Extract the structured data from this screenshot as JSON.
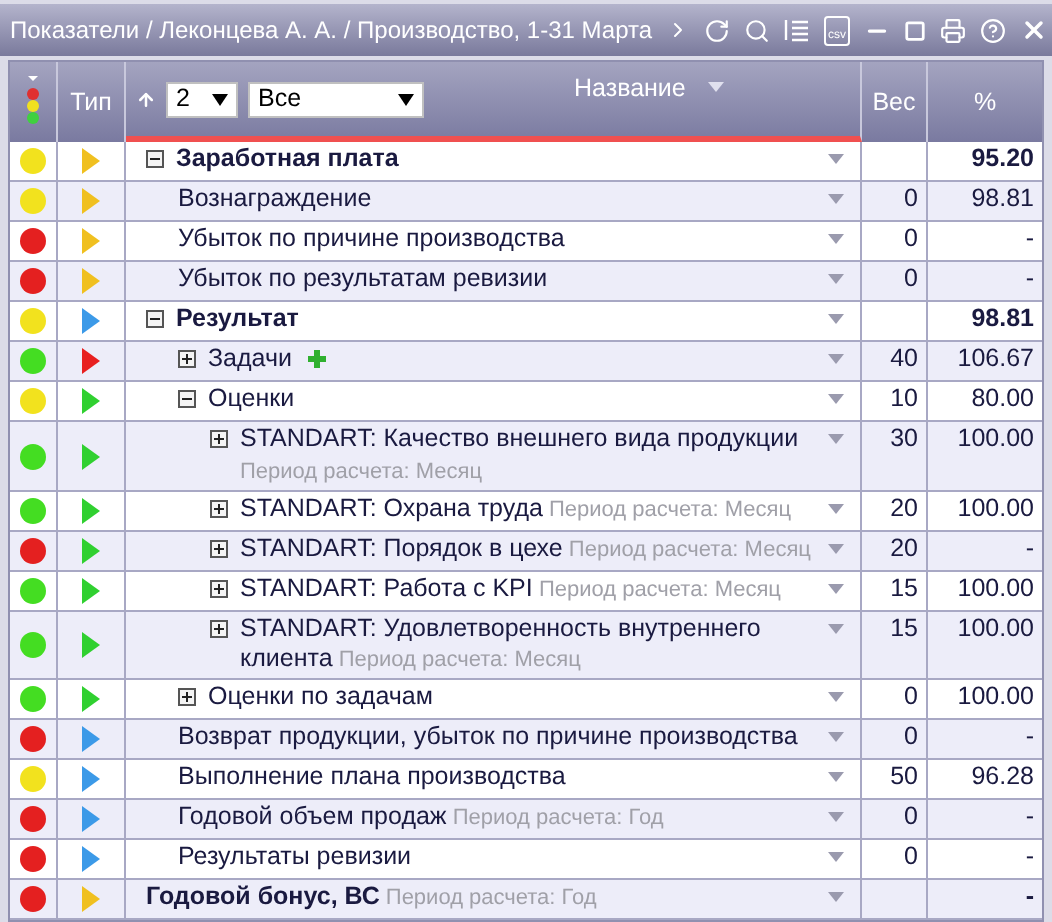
{
  "window": {
    "title": "Показатели / Леконцева А. А. / Производство, 1-31 Марта",
    "csv_label": "csv"
  },
  "header": {
    "type_label": "Тип",
    "level_select": "2",
    "filter_select": "Все",
    "name_label": "Название",
    "weight_label": "Вес",
    "percent_label": "%"
  },
  "rows": [
    {
      "name": "Заработная плата",
      "status": {
        "color": "#f2e21e"
      },
      "type": {
        "color": "#f0c020"
      },
      "expanded": true,
      "weight": "",
      "percent": "95.20",
      "children": [
        {
          "name": "Вознаграждение",
          "status": {
            "color": "#f2e21e"
          },
          "type": {
            "color": "#f0c020"
          },
          "weight": "0",
          "percent": "98.81"
        },
        {
          "name": "Убыток по причине производства",
          "status": {
            "color": "#e42020"
          },
          "type": {
            "color": "#f0c020"
          },
          "weight": "0",
          "percent": "-"
        },
        {
          "name": "Убыток по результатам ревизии",
          "status": {
            "color": "#e42020"
          },
          "type": {
            "color": "#f0c020"
          },
          "weight": "0",
          "percent": "-"
        }
      ]
    },
    {
      "name": "Результат",
      "status": {
        "color": "#f2e21e"
      },
      "type": {
        "color": "#3c9ae8"
      },
      "expanded": true,
      "weight": "",
      "percent": "98.81",
      "children": [
        {
          "name": "Задачи",
          "status": {
            "color": "#44dd22"
          },
          "type": {
            "color": "#e82020"
          },
          "expanded": false,
          "add_icon": true,
          "weight": "40",
          "percent": "106.67"
        },
        {
          "name": "Оценки",
          "status": {
            "color": "#f2e21e"
          },
          "type": {
            "color": "#30d030"
          },
          "expanded": true,
          "weight": "10",
          "percent": "80.00",
          "children": [
            {
              "name": "STANDART: Качество внешнего вида продукции",
              "period": "Период расчета: Месяц",
              "status": {
                "color": "#44dd22"
              },
              "type": {
                "color": "#30d030"
              },
              "expanded": false,
              "weight": "30",
              "percent": "100.00"
            },
            {
              "name": "STANDART: Охрана труда",
              "period": "Период расчета: Месяц",
              "status": {
                "color": "#44dd22"
              },
              "type": {
                "color": "#30d030"
              },
              "expanded": false,
              "weight": "20",
              "percent": "100.00"
            },
            {
              "name": "STANDART: Порядок в цехе",
              "period": "Период расчета: Месяц",
              "status": {
                "color": "#e42020"
              },
              "type": {
                "color": "#30d030"
              },
              "expanded": false,
              "weight": "20",
              "percent": "-"
            },
            {
              "name": "STANDART: Работа с KPI",
              "period": "Период расчета: Месяц",
              "status": {
                "color": "#44dd22"
              },
              "type": {
                "color": "#30d030"
              },
              "expanded": false,
              "weight": "15",
              "percent": "100.00"
            },
            {
              "name": "STANDART: Удовлетворенность внутреннего клиента",
              "period": "Период расчета: Месяц",
              "status": {
                "color": "#44dd22"
              },
              "type": {
                "color": "#30d030"
              },
              "expanded": false,
              "weight": "15",
              "percent": "100.00"
            }
          ]
        },
        {
          "name": "Оценки по задачам",
          "status": {
            "color": "#44dd22"
          },
          "type": {
            "color": "#30d030"
          },
          "expanded": false,
          "weight": "0",
          "percent": "100.00"
        },
        {
          "name": "Возврат продукции, убыток по причине производства",
          "status": {
            "color": "#e42020"
          },
          "type": {
            "color": "#3c9ae8"
          },
          "weight": "0",
          "percent": "-"
        },
        {
          "name": "Выполнение плана производства",
          "status": {
            "color": "#f2e21e"
          },
          "type": {
            "color": "#3c9ae8"
          },
          "weight": "50",
          "percent": "96.28"
        },
        {
          "name": "Годовой объем продаж",
          "period": "Период расчета: Год",
          "status": {
            "color": "#e42020"
          },
          "type": {
            "color": "#3c9ae8"
          },
          "weight": "0",
          "percent": "-"
        },
        {
          "name": "Результаты ревизии",
          "status": {
            "color": "#e42020"
          },
          "type": {
            "color": "#3c9ae8"
          },
          "weight": "0",
          "percent": "-"
        }
      ]
    },
    {
      "name": "Годовой бонус, ВС",
      "period": "Период расчета: Год",
      "status": {
        "color": "#e42020"
      },
      "type": {
        "color": "#f0c020"
      },
      "weight": "",
      "percent": "-"
    }
  ]
}
